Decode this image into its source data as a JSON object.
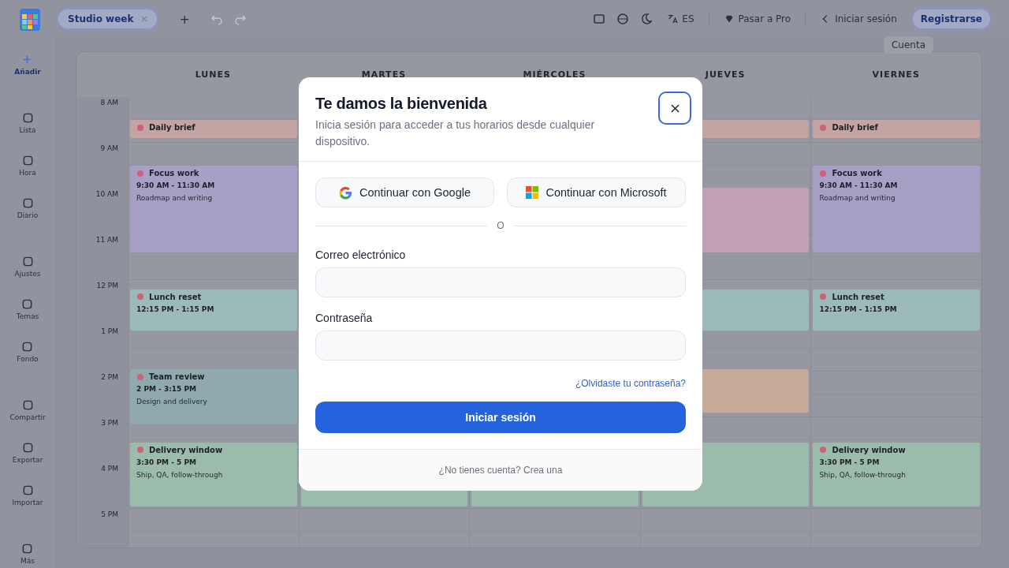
{
  "topbar": {
    "tab": "Studio week",
    "add": "+",
    "language": "ES",
    "upgrade": "Pasar a Pro",
    "sign_in": "Iniciar sesión",
    "register": "Registrarse",
    "tooltip": "Cuenta"
  },
  "sidebar": {
    "groups": [
      [
        {
          "label": "Añadir",
          "kind": "primary"
        }
      ],
      [
        {
          "label": "Lista",
          "kind": "item"
        },
        {
          "label": "Hora",
          "kind": "item"
        },
        {
          "label": "Diario",
          "kind": "item"
        }
      ],
      [
        {
          "label": "Ajustes",
          "kind": "item"
        },
        {
          "label": "Temas",
          "kind": "item"
        },
        {
          "label": "Fondo",
          "kind": "item"
        }
      ],
      [
        {
          "label": "Compartir",
          "kind": "item"
        },
        {
          "label": "Exportar",
          "kind": "item"
        },
        {
          "label": "Importar",
          "kind": "item"
        }
      ],
      [
        {
          "label": "Más",
          "kind": "item"
        }
      ]
    ]
  },
  "calendar": {
    "days": [
      "LUNES",
      "MARTES",
      "MIÉRCOLES",
      "JUEVES",
      "VIERNES"
    ],
    "times": [
      "8 AM",
      "9 AM",
      "10 AM",
      "11 AM",
      "12 PM",
      "1 PM",
      "2 PM",
      "3 PM",
      "4 PM",
      "5 PM"
    ],
    "columns": [
      {
        "events": [
          {
            "title": "Daily brief",
            "color": "#c3a4a2"
          },
          {
            "title": "Focus work",
            "time": "9:30 AM - 11:30 AM",
            "note": "Roadmap and writing",
            "color": "#a8a0c4"
          },
          {
            "title": "Lunch reset",
            "time": "12:15 PM - 1:15 PM",
            "color": "#9dbabb"
          },
          {
            "title": "Team review",
            "time": "2 PM - 3:15 PM",
            "note": "Design and delivery",
            "color": "#8fa9ac"
          },
          {
            "title": "Delivery window",
            "time": "3:30 PM - 5 PM",
            "note": "Ship, QA, follow-through",
            "color": "#9cbcab"
          }
        ]
      },
      {
        "events": [
          {
            "color": "#9cbcab"
          }
        ]
      },
      {
        "events": [
          {
            "color": "#9cbcab"
          }
        ]
      },
      {
        "events": [
          {
            "color": "#c3a4a2"
          },
          {
            "color": "#c19fb5"
          },
          {
            "color": "#9dbabb"
          },
          {
            "color": "#c6a996"
          },
          {
            "color": "#9cbcab"
          }
        ]
      },
      {
        "events": [
          {
            "title": "Daily brief",
            "color": "#c3a4a2"
          },
          {
            "title": "Focus work",
            "time": "9:30 AM - 11:30 AM",
            "note": "Roadmap and writing",
            "color": "#a8a0c4"
          },
          {
            "title": "Lunch reset",
            "time": "12:15 PM - 1:15 PM",
            "color": "#9dbabb"
          },
          {
            "title": "Delivery window",
            "time": "3:30 PM - 5 PM",
            "note": "Ship, QA, follow-through",
            "color": "#9cbcab"
          }
        ]
      }
    ]
  },
  "modal": {
    "title": "Te damos la bienvenida",
    "subtitle": "Inicia sesión para acceder a tus horarios desde cualquier dispositivo.",
    "providers": [
      "Continuar con Google",
      "Continuar con Microsoft"
    ],
    "divider": "O",
    "fields": [
      {
        "label": "Correo electrónico"
      },
      {
        "label": "Contraseña"
      }
    ],
    "forgot": "¿Olvidaste tu contraseña?",
    "submit": "Iniciar sesión",
    "footer": "¿No tienes cuenta? Crea una"
  }
}
